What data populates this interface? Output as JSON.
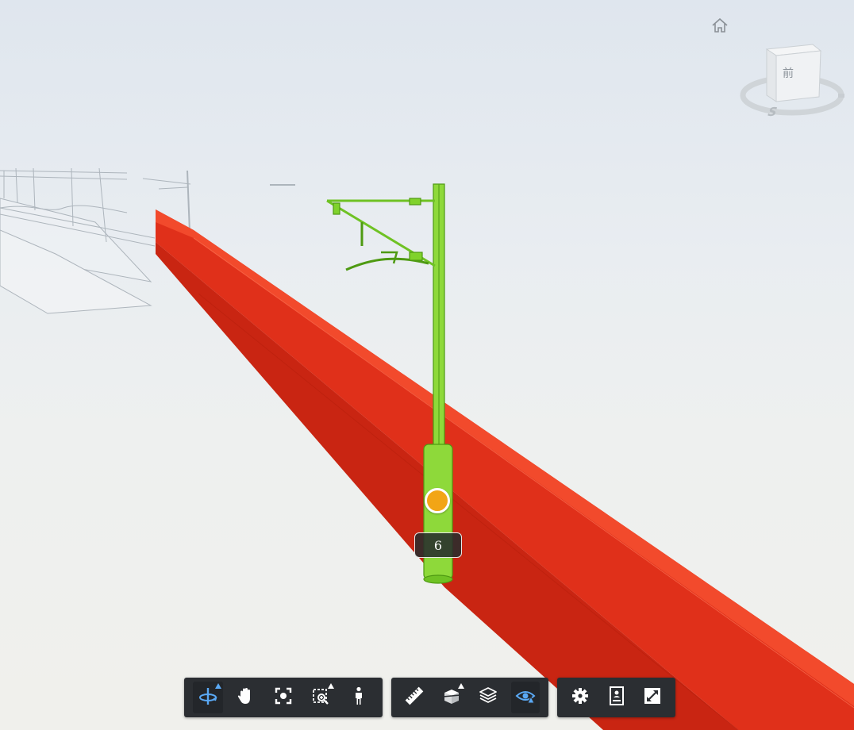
{
  "viewcube": {
    "face_label": "前",
    "compass_label": "S"
  },
  "marker": {
    "label": "6"
  },
  "colors": {
    "background_top": "#dfe6ee",
    "background_bottom": "#f0f0ec",
    "red_element": "#e62b14",
    "green_element": "#7fd12b",
    "marker": "#f2a516",
    "toolbar": "#2b2e32",
    "active_icon": "#5aa9f5"
  },
  "toolbar": {
    "groups": [
      {
        "name": "navigation",
        "tools": [
          {
            "icon": "orbit-icon",
            "active": true,
            "flyout": true
          },
          {
            "icon": "pan-hand-icon",
            "active": false,
            "flyout": false
          },
          {
            "icon": "zoom-extents-icon",
            "active": false,
            "flyout": false
          },
          {
            "icon": "zoom-window-icon",
            "active": false,
            "flyout": true
          },
          {
            "icon": "first-person-icon",
            "active": false,
            "flyout": false
          }
        ]
      },
      {
        "name": "analysis",
        "tools": [
          {
            "icon": "measure-ruler-icon",
            "active": false,
            "flyout": false
          },
          {
            "icon": "section-box-icon",
            "active": false,
            "flyout": true
          },
          {
            "icon": "layers-icon",
            "active": false,
            "flyout": false
          },
          {
            "icon": "explode-eye-icon",
            "active": true,
            "flyout": false
          }
        ]
      },
      {
        "name": "settings",
        "tools": [
          {
            "icon": "gear-icon",
            "active": false,
            "flyout": false
          },
          {
            "icon": "properties-icon",
            "active": false,
            "flyout": false
          },
          {
            "icon": "fullscreen-icon",
            "active": false,
            "flyout": false
          }
        ]
      }
    ]
  }
}
